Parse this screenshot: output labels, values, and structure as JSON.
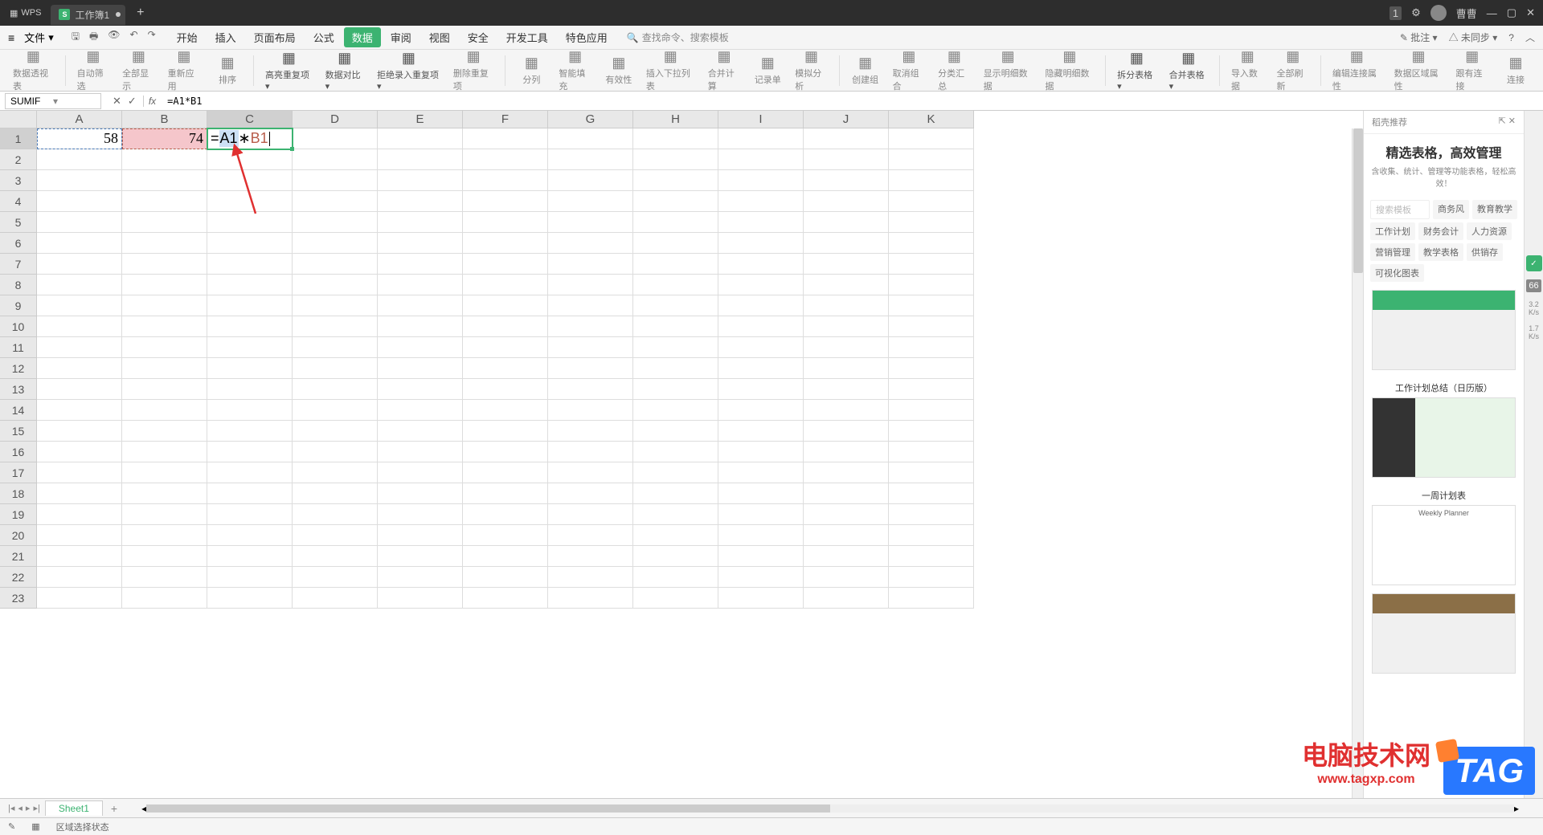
{
  "titlebar": {
    "app": "WPS",
    "doc_name": "工作簿1",
    "username": "曹曹",
    "n_badge": "1"
  },
  "menubar": {
    "file": "文件",
    "tabs": [
      "开始",
      "插入",
      "页面布局",
      "公式",
      "数据",
      "审阅",
      "视图",
      "安全",
      "开发工具",
      "特色应用"
    ],
    "active_tab_index": 4,
    "search_placeholder": "查找命令、搜索模板",
    "remark": "批注",
    "sync": "未同步"
  },
  "ribbon": {
    "items": [
      "数据透视表",
      "自动筛选",
      "全部显示",
      "重新应用",
      "排序",
      "高亮重复项",
      "数据对比",
      "拒绝录入重复项",
      "删除重复项",
      "分列",
      "智能填充",
      "有效性",
      "插入下拉列表",
      "合并计算",
      "记录单",
      "模拟分析",
      "创建组",
      "取消组合",
      "分类汇总",
      "显示明细数据",
      "隐藏明细数据",
      "拆分表格",
      "合并表格",
      "导入数据",
      "全部刷新",
      "编辑连接属性",
      "数据区域属性",
      "跟有连接",
      "连接"
    ]
  },
  "formula_bar": {
    "name_box": "SUMIF",
    "formula": "=A1*B1"
  },
  "sheet": {
    "columns": [
      "A",
      "B",
      "C",
      "D",
      "E",
      "F",
      "G",
      "H",
      "I",
      "J",
      "K"
    ],
    "row_count": 23,
    "a1_value": "58",
    "b1_value": "74",
    "c1_eq": "=",
    "c1_refA": "A1",
    "c1_star": " ∗ ",
    "c1_refB": "B1",
    "active_col": 2,
    "active_row": 0
  },
  "right_panel": {
    "header": "稻壳推荐",
    "title": "精选表格，高效管理",
    "subtitle": "含收集、统计、管理等功能表格，轻松高效！",
    "search": "搜索模板",
    "filters": [
      "商务风",
      "教育教学",
      "工作计划",
      "财务会计",
      "人力资源",
      "营销管理",
      "教学表格",
      "供销存",
      "可视化图表"
    ],
    "templates": [
      {
        "title": ""
      },
      {
        "title": "工作计划总结（日历版）"
      },
      {
        "title": "一周计划表"
      },
      {
        "title": ""
      }
    ]
  },
  "sidebar_stats": {
    "check": "✓",
    "num": "66",
    "s1": "3.2",
    "s1u": "K/s",
    "s2": "1.7",
    "s2u": "K/s"
  },
  "sheet_tabs": {
    "sheet1": "Sheet1"
  },
  "status_bar": {
    "status": "区域选择状态"
  },
  "watermark": {
    "line1": "电脑技术网",
    "line2": "www.tagxp.com",
    "tag": "TAG"
  }
}
